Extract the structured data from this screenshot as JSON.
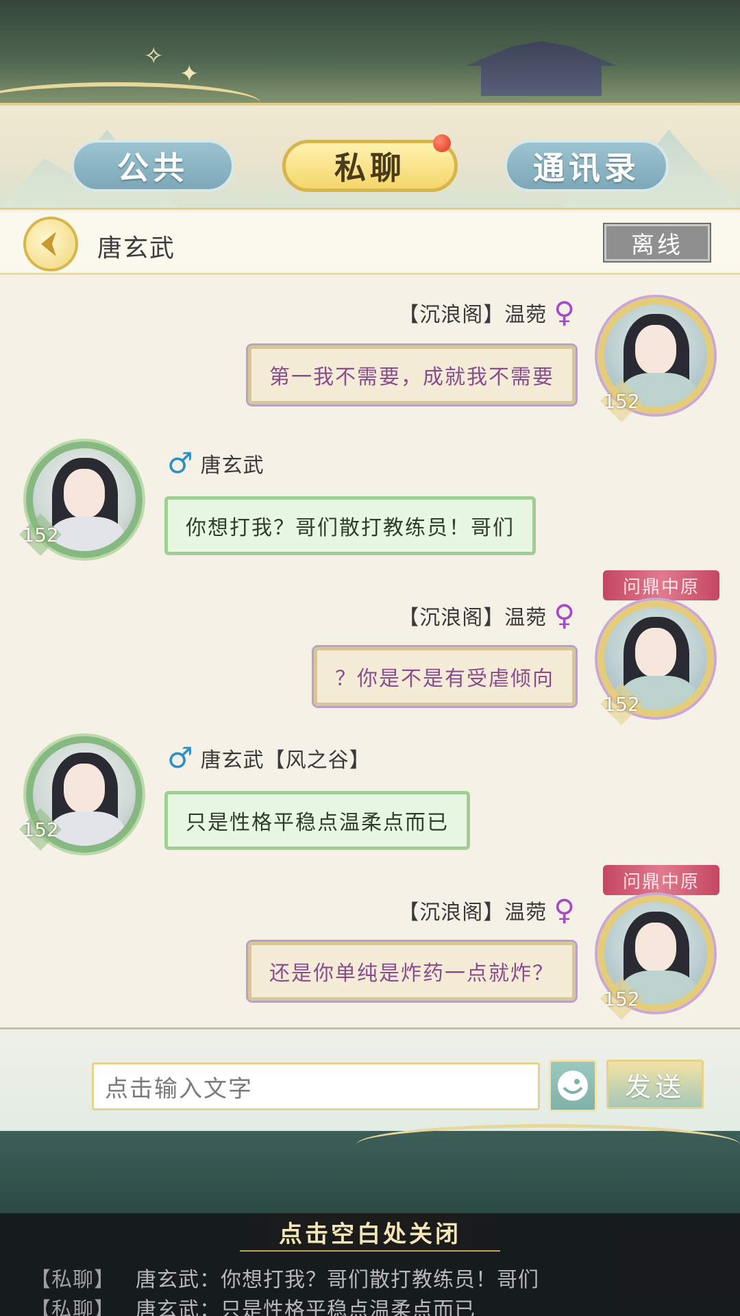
{
  "tabs": [
    {
      "label": "公共",
      "active": false
    },
    {
      "label": "私聊",
      "active": true
    },
    {
      "label": "通讯录",
      "active": false
    }
  ],
  "colors": {
    "active_tab": "#f4d66b",
    "inactive_tab": "#7da8b9",
    "female_bubble_text": "#8a4c8d",
    "male_bubble_bg": "#e8f7e1",
    "unread_dot": "#e0321f"
  },
  "chat_header": {
    "back_icon": "chevron-left-icon",
    "contact_name": "唐玄武",
    "status": "离线"
  },
  "messages": [
    {
      "side": "right",
      "sender": "【沉浪阁】温菀",
      "gender_icon": "♀",
      "level": "152",
      "title_banner": "",
      "text": "第一我不需要，成就我不需要"
    },
    {
      "side": "left",
      "sender": "唐玄武",
      "gender_icon": "♂",
      "level": "152",
      "text": "你想打我？哥们散打教练员！哥们"
    },
    {
      "side": "right",
      "sender": "【沉浪阁】温菀",
      "gender_icon": "♀",
      "level": "152",
      "title_banner": "问鼎中原",
      "text": "？你是不是有受虐倾向"
    },
    {
      "side": "left",
      "sender": "唐玄武【风之谷】",
      "gender_icon": "♂",
      "level": "152",
      "text": "只是性格平稳点温柔点而已"
    },
    {
      "side": "right",
      "sender": "【沉浪阁】温菀",
      "gender_icon": "♀",
      "level": "152",
      "title_banner": "问鼎中原",
      "text": "还是你单纯是炸药一点就炸？"
    }
  ],
  "input": {
    "placeholder": "点击输入文字",
    "emoji_icon": "smiley-icon",
    "send_label": "发送"
  },
  "bottom_log": {
    "close_hint": "点击空白处关闭",
    "lines": [
      {
        "tag": "【私聊】",
        "text": "唐玄武：你想打我？哥们散打教练员！哥们"
      },
      {
        "tag": "【私聊】",
        "text": "唐玄武：只是性格平稳点温柔点而已"
      }
    ]
  }
}
